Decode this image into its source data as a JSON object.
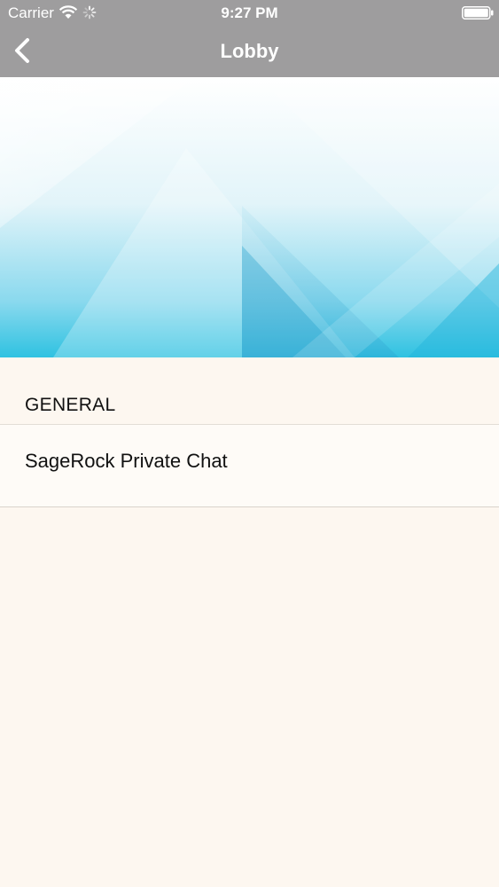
{
  "status_bar": {
    "carrier": "Carrier",
    "time": "9:27 PM",
    "icons": [
      "wifi-icon",
      "activity-spinner-icon",
      "battery-icon"
    ]
  },
  "nav": {
    "title": "Lobby",
    "back_icon": "chevron-left-icon"
  },
  "colors": {
    "nav_background": "#9e9d9e",
    "page_background": "#fdf7f0",
    "banner_accent": "#2bbfdf"
  },
  "sections": [
    {
      "header": "GENERAL",
      "items": [
        {
          "label": "SageRock Private Chat"
        }
      ]
    }
  ]
}
